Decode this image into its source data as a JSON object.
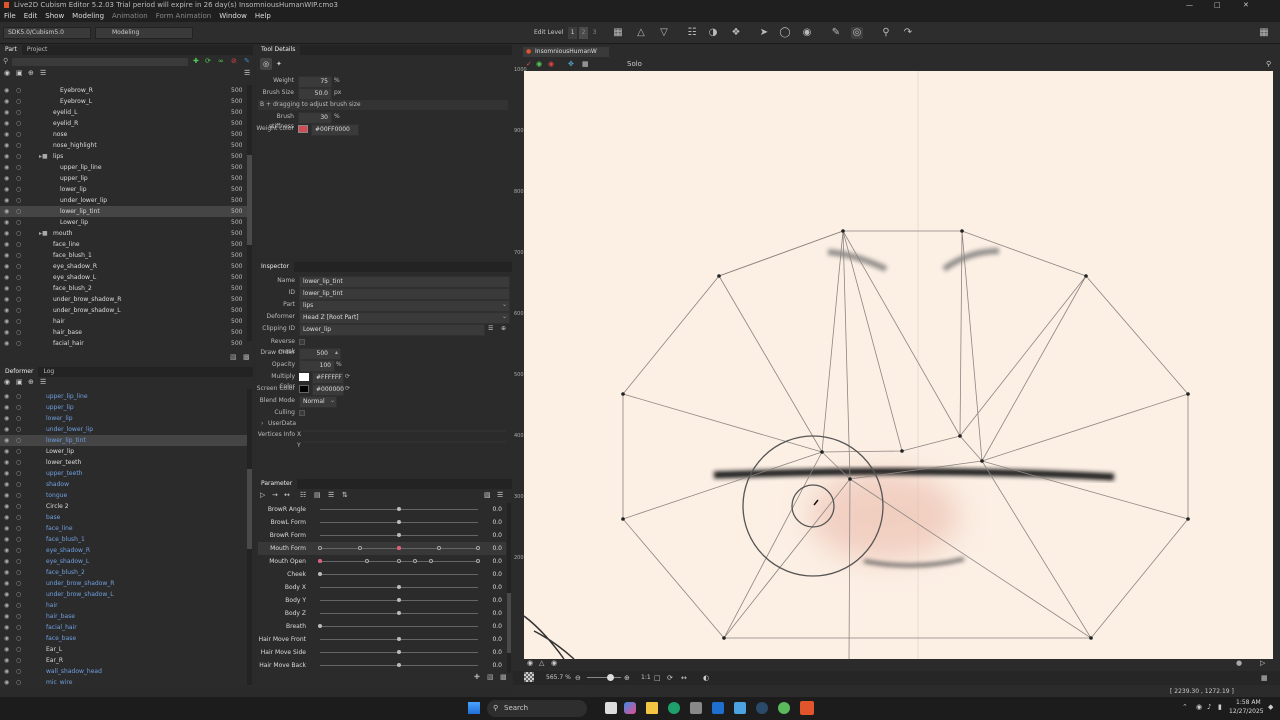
{
  "window": {
    "title": "Live2D Cubism Editor 5.2.03    Trial period will expire in 26 day(s)    InsomniousHumanWIP.cmo3"
  },
  "menu": [
    {
      "label": "File",
      "enabled": true
    },
    {
      "label": "Edit",
      "enabled": true
    },
    {
      "label": "Show",
      "enabled": true
    },
    {
      "label": "Modeling",
      "enabled": true
    },
    {
      "label": "Animation",
      "enabled": false
    },
    {
      "label": "Form Animation",
      "enabled": false
    },
    {
      "label": "Window",
      "enabled": true
    },
    {
      "label": "Help",
      "enabled": true
    }
  ],
  "toolbar": {
    "sdk_select": "SDK5.0/Cubism5.0",
    "mode_select": "Modeling",
    "edit_level_label": "Edit Level",
    "edit_levels": [
      "1",
      "2",
      "3"
    ]
  },
  "part_panel": {
    "tabs": [
      "Part",
      "Project"
    ],
    "rows": [
      {
        "name": "Eyebrow_R",
        "order": "500",
        "indent": 2
      },
      {
        "name": "Eyebrow_L",
        "order": "500",
        "indent": 2
      },
      {
        "name": "eyelid_L",
        "order": "500",
        "indent": 1
      },
      {
        "name": "eyelid_R",
        "order": "500",
        "indent": 1
      },
      {
        "name": "nose",
        "order": "500",
        "indent": 1
      },
      {
        "name": "nose_highlight",
        "order": "500",
        "indent": 1
      },
      {
        "name": "lips",
        "order": "500",
        "indent": 1,
        "folder": true
      },
      {
        "name": "upper_lip_line",
        "order": "500",
        "indent": 2
      },
      {
        "name": "upper_lip",
        "order": "500",
        "indent": 2
      },
      {
        "name": "lower_lip",
        "order": "500",
        "indent": 2
      },
      {
        "name": "under_lower_lip",
        "order": "500",
        "indent": 2
      },
      {
        "name": "lower_lip_tint",
        "order": "500",
        "indent": 2,
        "selected": true
      },
      {
        "name": "Lower_lip",
        "order": "500",
        "indent": 2
      },
      {
        "name": "mouth",
        "order": "500",
        "indent": 1,
        "folder": true
      },
      {
        "name": "face_line",
        "order": "500",
        "indent": 1
      },
      {
        "name": "face_blush_1",
        "order": "500",
        "indent": 1
      },
      {
        "name": "eye_shadow_R",
        "order": "500",
        "indent": 1
      },
      {
        "name": "eye_shadow_L",
        "order": "500",
        "indent": 1
      },
      {
        "name": "face_blush_2",
        "order": "500",
        "indent": 1
      },
      {
        "name": "under_brow_shadow_R",
        "order": "500",
        "indent": 1
      },
      {
        "name": "under_brow_shadow_L",
        "order": "500",
        "indent": 1
      },
      {
        "name": "hair",
        "order": "500",
        "indent": 1
      },
      {
        "name": "hair_base",
        "order": "500",
        "indent": 1
      },
      {
        "name": "facial_hair",
        "order": "500",
        "indent": 1
      }
    ]
  },
  "deformer_panel": {
    "tabs": [
      "Deformer",
      "Log"
    ],
    "rows": [
      {
        "name": "upper_lip_line"
      },
      {
        "name": "upper_lip"
      },
      {
        "name": "lower_lip"
      },
      {
        "name": "under_lower_lip"
      },
      {
        "name": "lower_lip_tint",
        "selected": true
      },
      {
        "name": "Lower_lip",
        "white": true
      },
      {
        "name": "lower_teeth",
        "white": true
      },
      {
        "name": "upper_teeth"
      },
      {
        "name": "shadow"
      },
      {
        "name": "tongue"
      },
      {
        "name": "Circle 2",
        "white": true
      },
      {
        "name": "base"
      },
      {
        "name": "face_line"
      },
      {
        "name": "face_blush_1"
      },
      {
        "name": "eye_shadow_R"
      },
      {
        "name": "eye_shadow_L"
      },
      {
        "name": "face_blush_2"
      },
      {
        "name": "under_brow_shadow_R"
      },
      {
        "name": "under_brow_shadow_L"
      },
      {
        "name": "hair"
      },
      {
        "name": "hair_base"
      },
      {
        "name": "facial_hair"
      },
      {
        "name": "face_base"
      },
      {
        "name": "Ear_L",
        "white": true
      },
      {
        "name": "Ear_R",
        "white": true
      },
      {
        "name": "wall_shadow_head"
      },
      {
        "name": "mic_wire"
      }
    ]
  },
  "tool_details": {
    "title": "Tool Details",
    "weight_label": "Weight",
    "weight_value": "75",
    "weight_unit": "%",
    "brush_size_label": "Brush Size",
    "brush_size_value": "50.0",
    "brush_size_unit": "px",
    "hint": "B + dragging to adjust brush size",
    "stiffness_label": "Brush stiffness",
    "stiffness_value": "30",
    "stiffness_unit": "%",
    "weight_color_label": "Weight color",
    "weight_color_value": "#00FF0000",
    "weight_color_hex": "#d44a55"
  },
  "inspector": {
    "title": "Inspector",
    "fields": [
      {
        "label": "Name",
        "value": "lower_lip_tint"
      },
      {
        "label": "ID",
        "value": "lower_lip_tint"
      },
      {
        "label": "Part",
        "value": "lips"
      },
      {
        "label": "Deformer",
        "value": "Head Z  [Root Part]"
      },
      {
        "label": "Clipping ID",
        "value": "Lower_lip"
      }
    ],
    "reverse_mask_label": "Reverse mask",
    "draw_order_label": "Draw Order",
    "draw_order_value": "500",
    "opacity_label": "Opacity",
    "opacity_value": "100",
    "opacity_unit": "%",
    "multiply_label": "Multiply Color",
    "multiply_value": "#FFFFFF",
    "screen_label": "Screen Color",
    "screen_value": "#000000",
    "blend_label": "Blend Mode",
    "blend_value": "Normal",
    "culling_label": "Culling",
    "userdata_label": "UserData",
    "vertices_label": "Vertices Info",
    "vx_label": "X",
    "vy_label": "Y"
  },
  "parameter": {
    "title": "Parameter",
    "rows": [
      {
        "label": "BrowR Angle",
        "value": "0.0",
        "pos": 0.5,
        "keys": []
      },
      {
        "label": "BrowL Form",
        "value": "0.0",
        "pos": 0.5,
        "keys": []
      },
      {
        "label": "BrowR Form",
        "value": "0.0",
        "pos": 0.5,
        "keys": []
      },
      {
        "label": "Mouth Form",
        "value": "0.0",
        "pos": 0.5,
        "keys": [
          0,
          0.25,
          0.5,
          0.75,
          1
        ],
        "highlight": true
      },
      {
        "label": "Mouth Open",
        "value": "0.0",
        "pos": 0,
        "keys": [
          0,
          0.3,
          0.5,
          0.6,
          0.7,
          1
        ]
      },
      {
        "label": "Cheek",
        "value": "0.0",
        "pos": 0,
        "keys": []
      },
      {
        "label": "Body X",
        "value": "0.0",
        "pos": 0.5,
        "keys": []
      },
      {
        "label": "Body Y",
        "value": "0.0",
        "pos": 0.5,
        "keys": []
      },
      {
        "label": "Body Z",
        "value": "0.0",
        "pos": 0.5,
        "keys": []
      },
      {
        "label": "Breath",
        "value": "0.0",
        "pos": 0,
        "keys": []
      },
      {
        "label": "Hair Move Front",
        "value": "0.0",
        "pos": 0.5,
        "keys": []
      },
      {
        "label": "Hair Move Side",
        "value": "0.0",
        "pos": 0.5,
        "keys": []
      },
      {
        "label": "Hair Move Back",
        "value": "0.0",
        "pos": 0.5,
        "keys": []
      }
    ]
  },
  "viewport": {
    "tab": "InsomniousHumanW",
    "solo_label": "Solo",
    "ruler_ticks": [
      "1000",
      "900",
      "800",
      "700",
      "600",
      "500",
      "400",
      "300",
      "200"
    ],
    "zoom": "565.7 %",
    "ratio": "1:1",
    "coords": "[ 2239.30 , 1272.19 ]",
    "canvas_bg": "#fcefe4"
  },
  "taskbar": {
    "search_placeholder": "Search",
    "time": "1:58 AM",
    "date": "12/27/2025"
  }
}
